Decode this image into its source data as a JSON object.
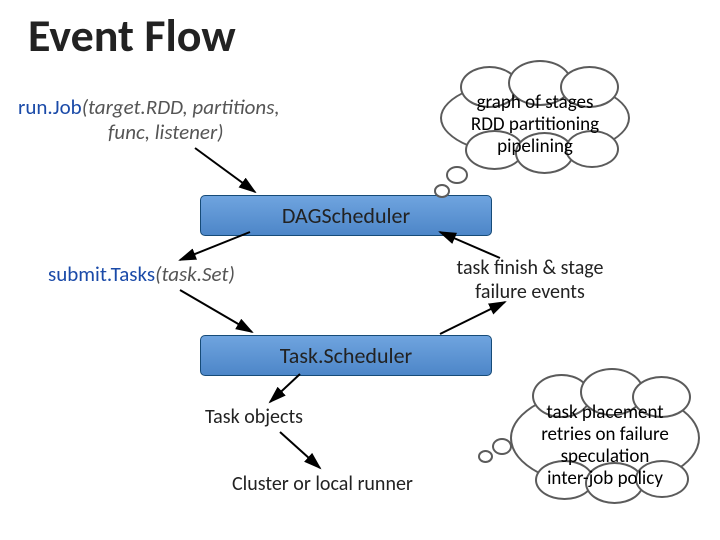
{
  "title": "Event Flow",
  "call1": {
    "method": "run.Job",
    "args1": "(target.RDD, partitions,",
    "args2": "func, listener)"
  },
  "cloud1": {
    "line1": "graph of stages",
    "line2": "RDD partitioning",
    "line3": "pipelining"
  },
  "box1": "DAGScheduler",
  "call2": {
    "method": "submit.Tasks",
    "args": "(task.Set)"
  },
  "event1": {
    "line1": "task finish & stage",
    "line2": "failure events"
  },
  "box2": "Task.Scheduler",
  "label1": "Task objects",
  "label2": "Cluster or local runner",
  "cloud2": {
    "line1": "task placement",
    "line2": "retries on failure",
    "line3": "speculation",
    "line4": "inter-job policy"
  }
}
